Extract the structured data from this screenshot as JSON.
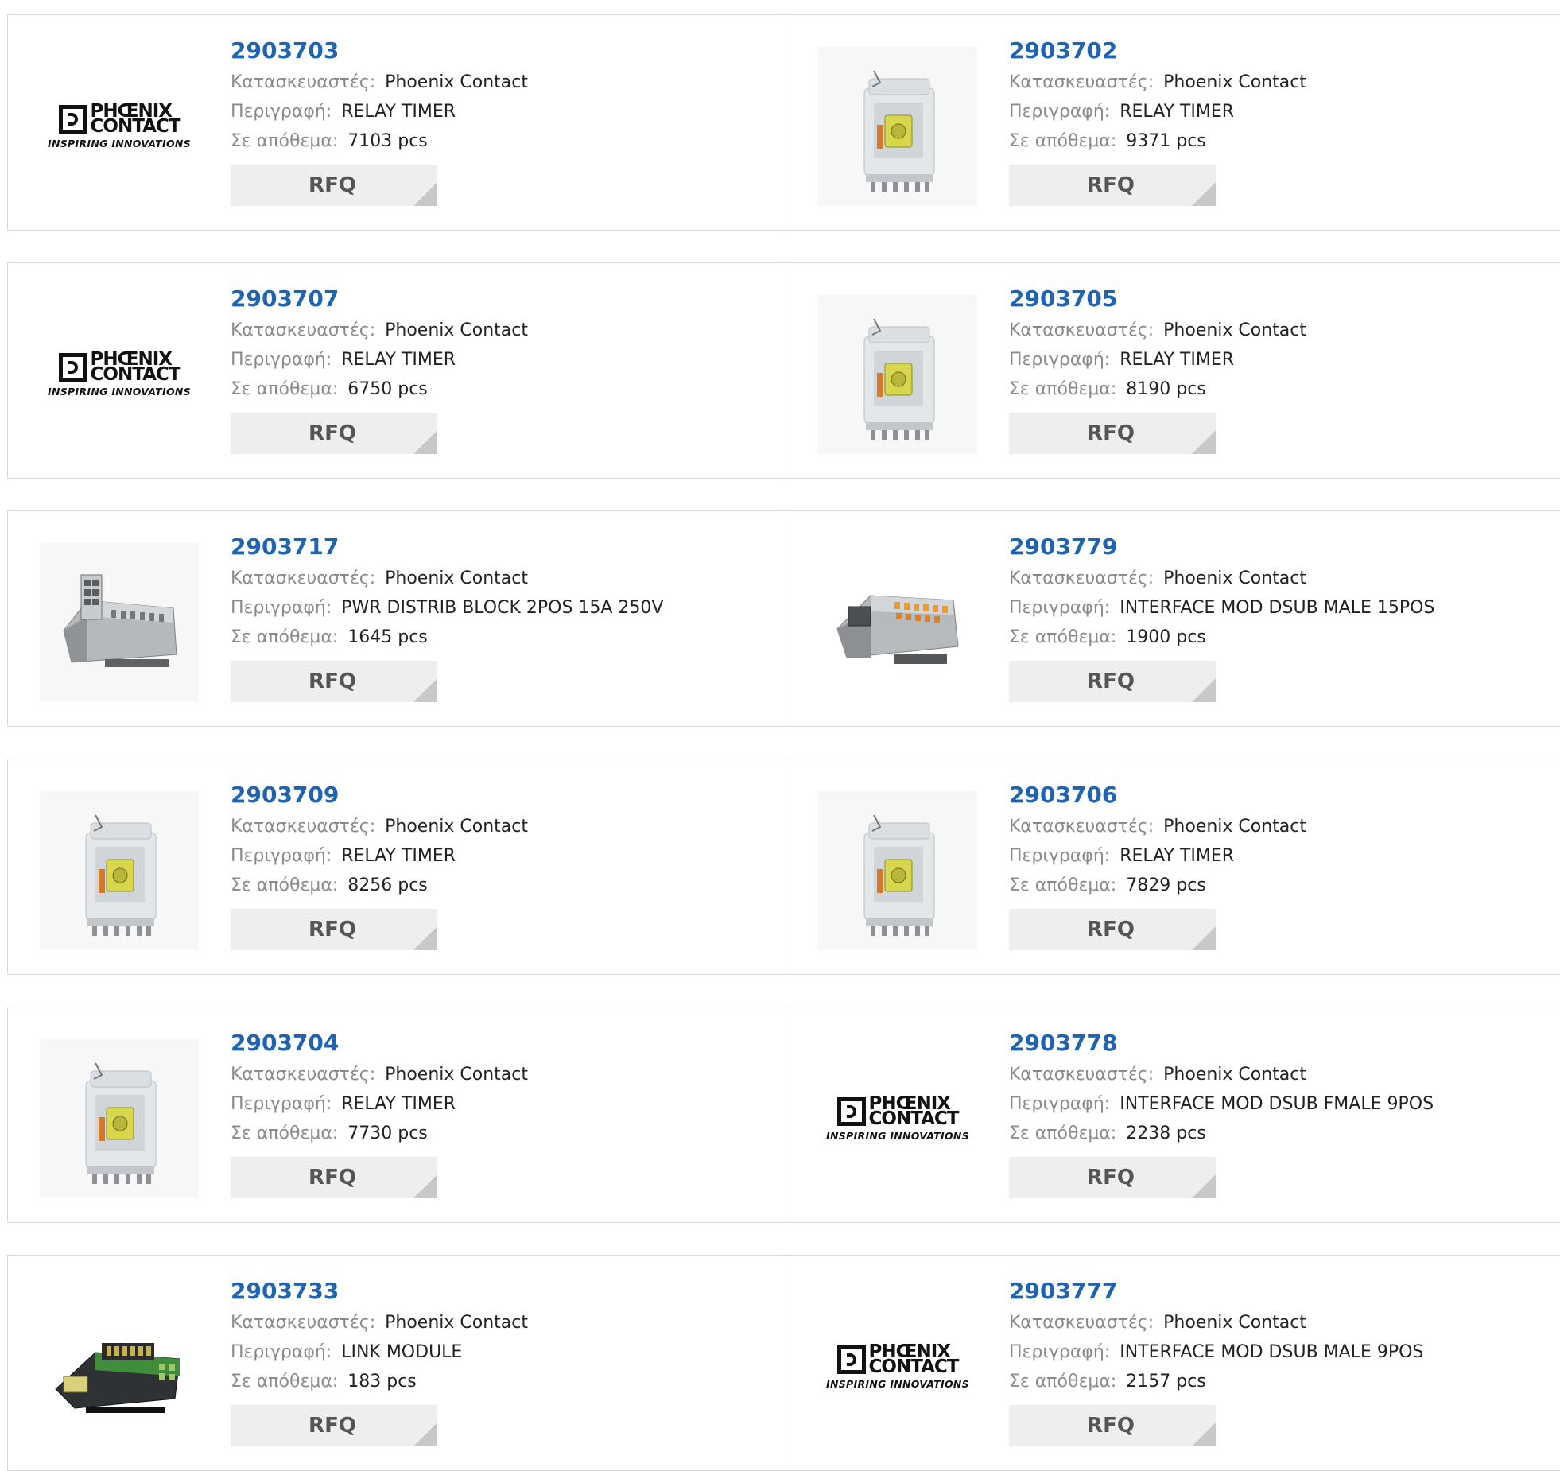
{
  "labels": {
    "manufacturer": "Κατασκευαστές:",
    "description": "Περιγραφή:",
    "stock": "Σε απόθεμα:",
    "rfq": "RFQ"
  },
  "logo": {
    "line1": "PHŒNIX",
    "line2": "CONTACT",
    "tagline": "INSPIRING INNOVATIONS"
  },
  "products": [
    {
      "part": "2903703",
      "manufacturer": "Phoenix Contact",
      "description": "RELAY TIMER",
      "stock": "7103 pcs",
      "image": "phoenix-contact-logo"
    },
    {
      "part": "2903702",
      "manufacturer": "Phoenix Contact",
      "description": "RELAY TIMER",
      "stock": "9371 pcs",
      "image": "relay-photo"
    },
    {
      "part": "2903707",
      "manufacturer": "Phoenix Contact",
      "description": "RELAY TIMER",
      "stock": "6750 pcs",
      "image": "phoenix-contact-logo"
    },
    {
      "part": "2903705",
      "manufacturer": "Phoenix Contact",
      "description": "RELAY TIMER",
      "stock": "8190 pcs",
      "image": "relay-photo"
    },
    {
      "part": "2903717",
      "manufacturer": "Phoenix Contact",
      "description": "PWR DISTRIB BLOCK 2POS 15A 250V",
      "stock": "1645 pcs",
      "image": "distribution-block-photo"
    },
    {
      "part": "2903779",
      "manufacturer": "Phoenix Contact",
      "description": "INTERFACE MOD DSUB MALE 15POS",
      "stock": "1900 pcs",
      "image": "interface-module-photo"
    },
    {
      "part": "2903709",
      "manufacturer": "Phoenix Contact",
      "description": "RELAY TIMER",
      "stock": "8256 pcs",
      "image": "relay-photo"
    },
    {
      "part": "2903706",
      "manufacturer": "Phoenix Contact",
      "description": "RELAY TIMER",
      "stock": "7829 pcs",
      "image": "relay-photo"
    },
    {
      "part": "2903704",
      "manufacturer": "Phoenix Contact",
      "description": "RELAY TIMER",
      "stock": "7730 pcs",
      "image": "relay-photo"
    },
    {
      "part": "2903778",
      "manufacturer": "Phoenix Contact",
      "description": "INTERFACE MOD DSUB FMALE 9POS",
      "stock": "2238 pcs",
      "image": "phoenix-contact-logo"
    },
    {
      "part": "2903733",
      "manufacturer": "Phoenix Contact",
      "description": "LINK MODULE",
      "stock": "183 pcs",
      "image": "link-module-photo"
    },
    {
      "part": "2903777",
      "manufacturer": "Phoenix Contact",
      "description": "INTERFACE MOD DSUB MALE 9POS",
      "stock": "2157 pcs",
      "image": "phoenix-contact-logo"
    }
  ]
}
